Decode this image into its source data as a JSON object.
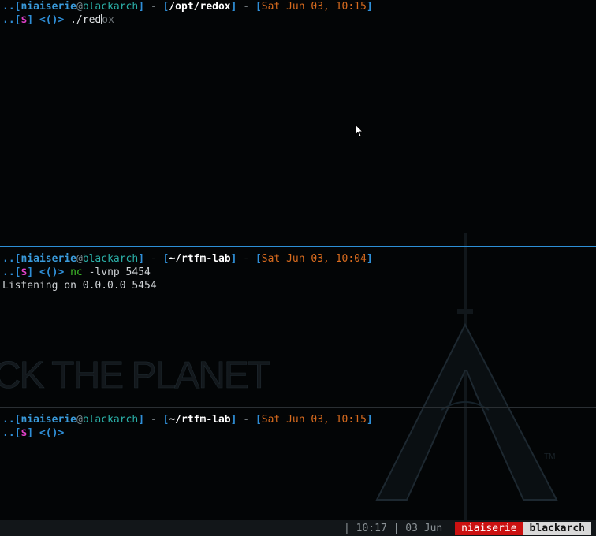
{
  "panes": [
    {
      "header": {
        "dots": "..",
        "open": "[",
        "user": "niaiserie",
        "at": "@",
        "host": "blackarch",
        "close": "]",
        "dash1": " - ",
        "path_open": "[",
        "path": "/opt/redox",
        "path_close": "]",
        "dash2": " - ",
        "date_open": "[",
        "date": "Sat Jun 03, 10:15",
        "date_close": "]"
      },
      "prompt": {
        "dots": "..",
        "open": "[",
        "symbol": "$",
        "close": "]",
        "arrow": " <()> "
      },
      "command_typed": "./red",
      "command_suggestion": "ox"
    },
    {
      "header": {
        "dots": "..",
        "open": "[",
        "user": "niaiserie",
        "at": "@",
        "host": "blackarch",
        "close": "]",
        "dash1": " - ",
        "path_open": "[",
        "path": "~/rtfm-lab",
        "path_close": "]",
        "dash2": " - ",
        "date_open": "[",
        "date": "Sat Jun 03, 10:04",
        "date_close": "]"
      },
      "prompt": {
        "dots": "..",
        "open": "[",
        "symbol": "$",
        "close": "]",
        "arrow": " <()> "
      },
      "command_name": "nc",
      "command_args": " -lvnp 5454",
      "output": "Listening on 0.0.0.0 5454"
    },
    {
      "header": {
        "dots": "..",
        "open": "[",
        "user": "niaiserie",
        "at": "@",
        "host": "blackarch",
        "close": "]",
        "dash1": " - ",
        "path_open": "[",
        "path": "~/rtfm-lab",
        "path_close": "]",
        "dash2": " - ",
        "date_open": "[",
        "date": "Sat Jun 03, 10:15",
        "date_close": "]"
      },
      "prompt": {
        "dots": "..",
        "open": "[",
        "symbol": "$",
        "close": "]",
        "arrow": " <()> "
      }
    }
  ],
  "wallpaper": {
    "slogan": "CK THE PLANET",
    "logo": "blackarch-logo",
    "tm": "TM"
  },
  "statusbar": {
    "time_segment": "| 10:17 | 03 Jun ",
    "user": "niaiserie",
    "host": "blackarch"
  },
  "colors": {
    "accent_blue": "#2f8fd8",
    "host_teal": "#2bb0a8",
    "date_orange": "#d86b1f",
    "dollar_magenta": "#e040c8",
    "nc_green": "#3fbf2a",
    "status_user_bg": "#cc1111",
    "status_host_bg": "#d9d9d9"
  },
  "icons": [
    "mouse-pointer-icon",
    "blackarch-logo"
  ]
}
